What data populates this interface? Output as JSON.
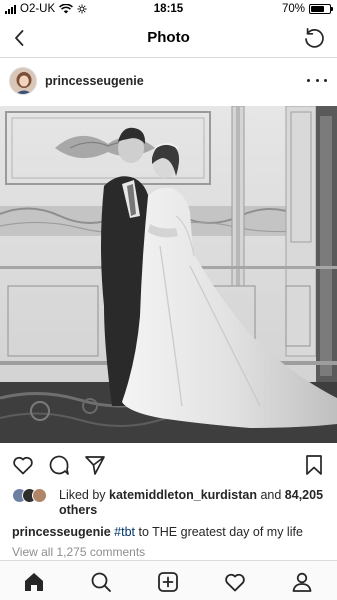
{
  "status_bar": {
    "carrier": "O2-UK",
    "time": "18:15",
    "battery": "70%",
    "battery_level": 0.7
  },
  "nav": {
    "title": "Photo",
    "back_icon": "chevron-left-icon",
    "refresh_icon": "refresh-icon"
  },
  "post": {
    "username": "princesseugenie",
    "more_icon": "more-horizontal-icon"
  },
  "actions": {
    "like_icon": "heart-icon",
    "comment_icon": "comment-icon",
    "share_icon": "send-icon",
    "save_icon": "bookmark-icon"
  },
  "likes": {
    "prefix": "Liked by ",
    "user": "katemiddleton_kurdistan",
    "middle": " and ",
    "others": "84,205 others"
  },
  "caption": {
    "user": "princesseugenie",
    "hashtag": "#tbt",
    "text": " to THE greatest day of my life"
  },
  "comments_link": "View all 1,275 comments",
  "tabbar": {
    "items": [
      "home-icon",
      "search-icon",
      "add-post-icon",
      "activity-heart-icon",
      "profile-icon"
    ]
  }
}
